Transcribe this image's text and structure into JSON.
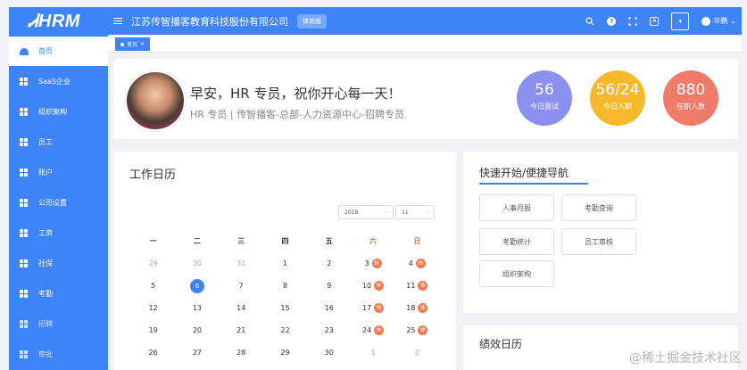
{
  "logo": "ᏗHRM",
  "sidebar": {
    "items": [
      {
        "label": "首页",
        "icon": "home-icon"
      },
      {
        "label": "SaaS企业",
        "icon": "grid-icon"
      },
      {
        "label": "组织架构",
        "icon": "grid-icon"
      },
      {
        "label": "员工",
        "icon": "grid-icon"
      },
      {
        "label": "账户",
        "icon": "grid-icon"
      },
      {
        "label": "公司设置",
        "icon": "grid-icon"
      },
      {
        "label": "工资",
        "icon": "grid-icon"
      },
      {
        "label": "社保",
        "icon": "grid-icon"
      },
      {
        "label": "考勤",
        "icon": "grid-icon"
      },
      {
        "label": "招聘",
        "icon": "grid-icon"
      },
      {
        "label": "审批",
        "icon": "grid-icon"
      }
    ]
  },
  "header": {
    "company": "江苏传智播客教育科技股份有限公司",
    "badge": "体验版",
    "user": "华鹏"
  },
  "tabs": [
    {
      "label": "首页",
      "close": "×"
    }
  ],
  "welcome": {
    "greeting": "早安，HR 专员，祝你开心每一天！",
    "subline": "HR 专员 | 传智播客-总部-人力资源中心-招聘专员",
    "stats": [
      {
        "value": "56",
        "label": "今日面试",
        "color": "#8b8ff0"
      },
      {
        "value": "56/24",
        "label": "今日入职",
        "color": "#f6b92c"
      },
      {
        "value": "880",
        "label": "在职人数",
        "color": "#f07b68"
      }
    ]
  },
  "calendar": {
    "title": "工作日历",
    "year": "2018",
    "month": "11",
    "weekdays": [
      "一",
      "二",
      "三",
      "四",
      "五",
      "六",
      "日"
    ],
    "rest_label": "休",
    "rows": [
      [
        "29",
        "30",
        "31",
        "1",
        "2",
        "3",
        "4"
      ],
      [
        "5",
        "6",
        "7",
        "8",
        "9",
        "10",
        "11"
      ],
      [
        "12",
        "13",
        "14",
        "15",
        "16",
        "17",
        "18"
      ],
      [
        "19",
        "20",
        "21",
        "22",
        "23",
        "24",
        "25"
      ],
      [
        "26",
        "27",
        "28",
        "29",
        "30",
        "1",
        "2"
      ]
    ]
  },
  "quick": {
    "title": "快速开始/便捷导航",
    "buttons": [
      "人事月报",
      "考勤查询",
      "考勤统计",
      "员工审核",
      "组织架构"
    ]
  },
  "bottom": {
    "title": "绩效日历"
  },
  "watermark": "@稀土掘金技术社区"
}
